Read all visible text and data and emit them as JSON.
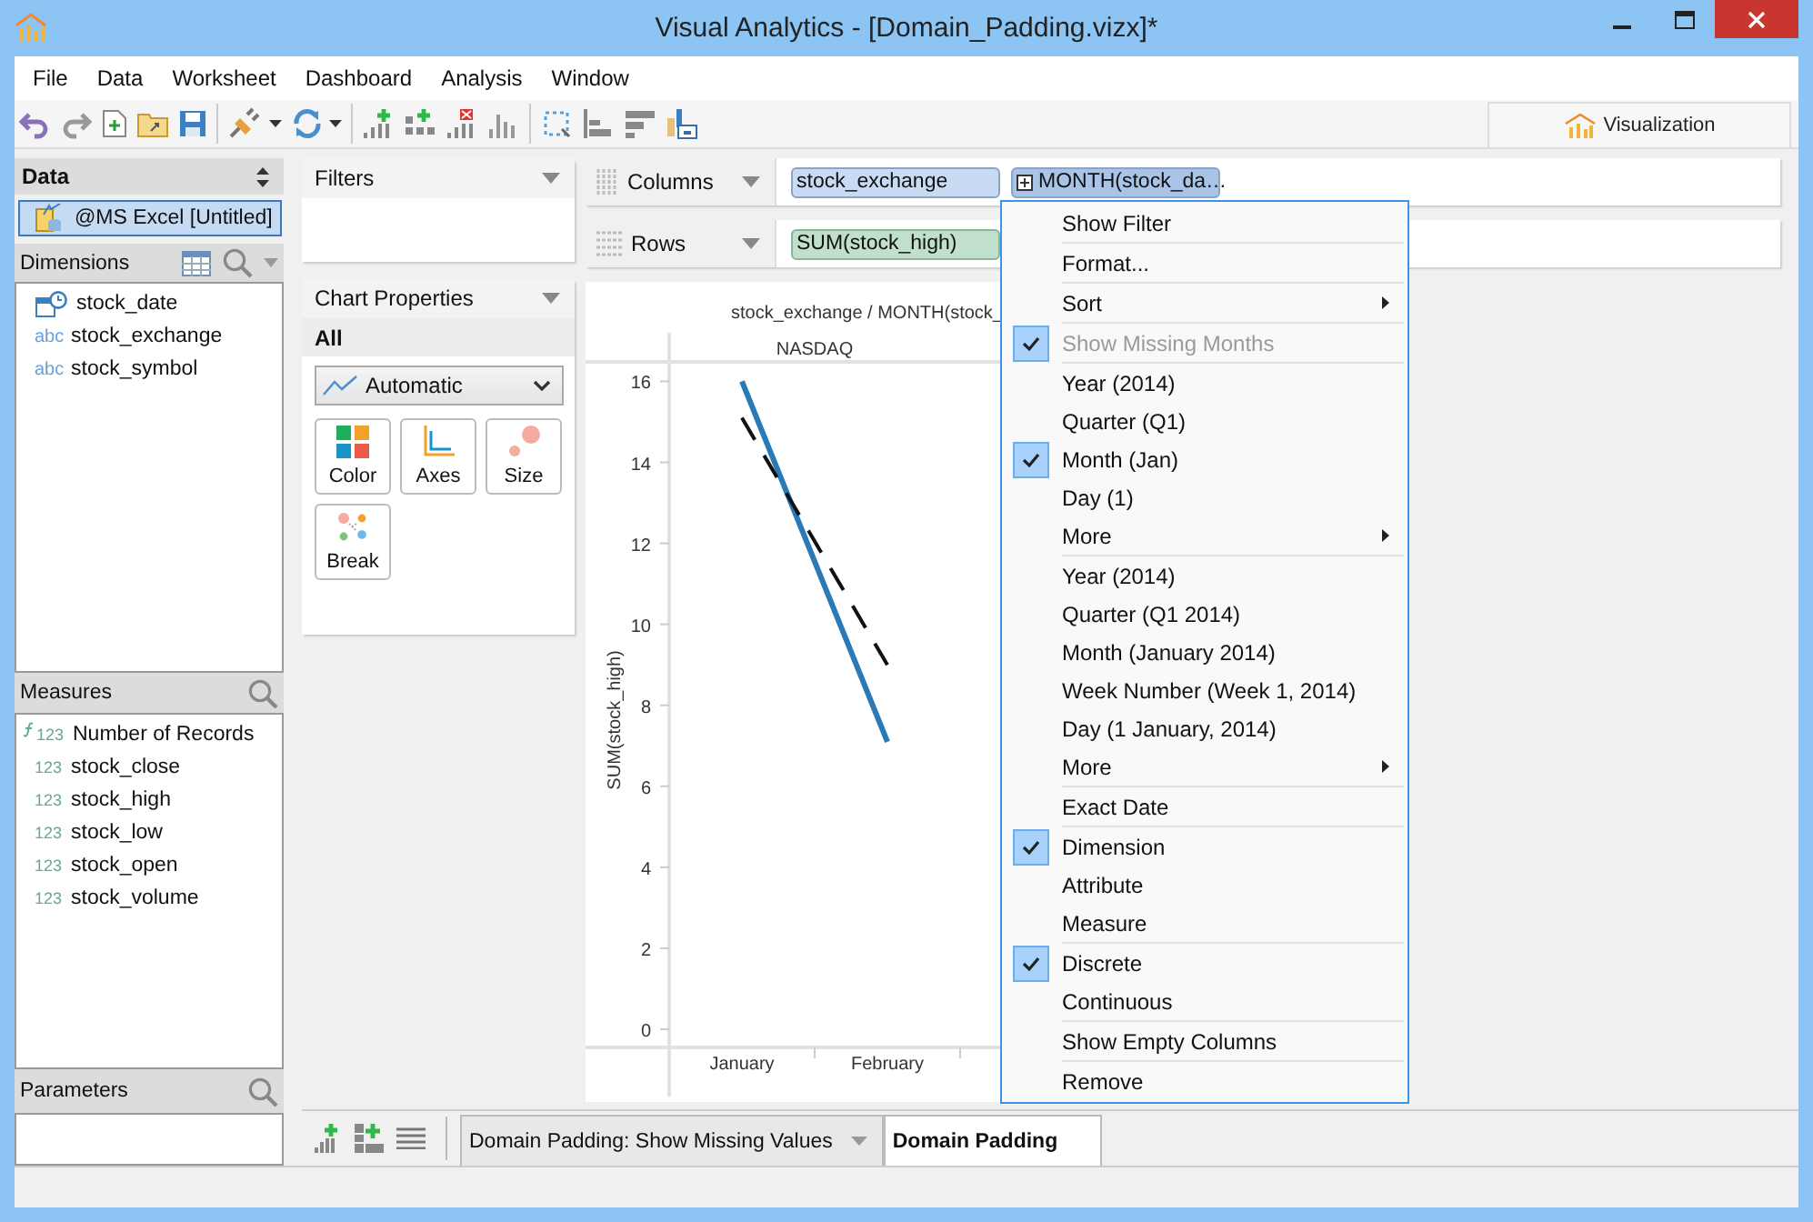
{
  "window": {
    "title": "Visual Analytics - [Domain_Padding.vizx]*"
  },
  "menu": [
    "File",
    "Data",
    "Worksheet",
    "Dashboard",
    "Analysis",
    "Window"
  ],
  "toolbar_tab": {
    "label": "Visualization"
  },
  "data_panel": {
    "title": "Data",
    "source": {
      "label": "@MS Excel [Untitled]",
      "selected": true
    }
  },
  "dimensions": {
    "title": "Dimensions",
    "items": [
      {
        "kind": "date",
        "label": "stock_date"
      },
      {
        "kind": "text",
        "badge": "abc",
        "label": "stock_exchange"
      },
      {
        "kind": "text",
        "badge": "abc",
        "label": "stock_symbol"
      }
    ]
  },
  "measures": {
    "title": "Measures",
    "items": [
      {
        "kind": "calculated",
        "badge": "123",
        "label": "Number of Records"
      },
      {
        "kind": "number",
        "badge": "123",
        "label": "stock_close"
      },
      {
        "kind": "number",
        "badge": "123",
        "label": "stock_high"
      },
      {
        "kind": "number",
        "badge": "123",
        "label": "stock_low"
      },
      {
        "kind": "number",
        "badge": "123",
        "label": "stock_open"
      },
      {
        "kind": "number",
        "badge": "123",
        "label": "stock_volume"
      }
    ]
  },
  "parameters": {
    "title": "Parameters"
  },
  "filters": {
    "title": "Filters"
  },
  "chart_properties": {
    "title": "Chart Properties",
    "section": "All",
    "mark_type": "Automatic",
    "buttons": [
      {
        "kind": "color",
        "label": "Color"
      },
      {
        "kind": "axes",
        "label": "Axes"
      },
      {
        "kind": "size",
        "label": "Size"
      },
      {
        "kind": "break",
        "label": "Break"
      }
    ]
  },
  "shelves": [
    {
      "kind": "columns",
      "label": "Columns",
      "pills": [
        {
          "kind": "dimension",
          "label": "stock_exchange"
        },
        {
          "kind": "date",
          "label": "MONTH(stock_da…"
        }
      ]
    },
    {
      "kind": "rows",
      "label": "Rows",
      "pills": [
        {
          "kind": "measure",
          "label": "SUM(stock_high)"
        }
      ]
    }
  ],
  "chart": {
    "header": "stock_exchange / MONTH(stock_",
    "pane": "NASDAQ",
    "chart_data": {
      "type": "line",
      "ylabel": "SUM(stock_high)",
      "categories": [
        "January",
        "February",
        null
      ],
      "ylim": [
        -0.45,
        17.2
      ],
      "yticks": [
        0,
        2,
        4,
        6,
        8,
        10,
        12,
        14,
        16
      ],
      "series": [
        {
          "color": "#2a7ab8",
          "line_style": "solid",
          "values": [
            16,
            7.1,
            null
          ]
        },
        {
          "color": "#111111",
          "line_style": "dashed",
          "values": [
            15.1,
            9.0,
            null
          ]
        }
      ]
    }
  },
  "sheet_tabs": [
    {
      "label": "Domain Padding: Show Missing Values",
      "selected": false
    },
    {
      "label": "Domain Padding",
      "selected": true
    }
  ],
  "context_menu": [
    {
      "items": [
        {
          "label": "Show Filter",
          "checked": false,
          "disabled": false,
          "submenu": false
        }
      ]
    },
    {
      "items": [
        {
          "label": "Format...",
          "checked": false,
          "disabled": false,
          "submenu": false
        }
      ]
    },
    {
      "items": [
        {
          "label": "Sort",
          "checked": false,
          "disabled": false,
          "submenu": true
        }
      ]
    },
    {
      "items": [
        {
          "label": "Show Missing Months",
          "checked": true,
          "disabled": true,
          "submenu": false
        }
      ]
    },
    {
      "items": [
        {
          "label": "Year (2014)",
          "checked": false,
          "disabled": false,
          "submenu": false
        },
        {
          "label": "Quarter (Q1)",
          "checked": false,
          "disabled": false,
          "submenu": false
        },
        {
          "label": "Month (Jan)",
          "checked": true,
          "disabled": false,
          "submenu": false
        },
        {
          "label": "Day (1)",
          "checked": false,
          "disabled": false,
          "submenu": false
        },
        {
          "label": "More",
          "checked": false,
          "disabled": false,
          "submenu": true
        }
      ]
    },
    {
      "items": [
        {
          "label": "Year (2014)",
          "checked": false,
          "disabled": false,
          "submenu": false
        },
        {
          "label": "Quarter (Q1 2014)",
          "checked": false,
          "disabled": false,
          "submenu": false
        },
        {
          "label": "Month (January 2014)",
          "checked": false,
          "disabled": false,
          "submenu": false
        },
        {
          "label": "Week Number (Week 1, 2014)",
          "checked": false,
          "disabled": false,
          "submenu": false
        },
        {
          "label": "Day (1 January, 2014)",
          "checked": false,
          "disabled": false,
          "submenu": false
        },
        {
          "label": "More",
          "checked": false,
          "disabled": false,
          "submenu": true
        }
      ]
    },
    {
      "items": [
        {
          "label": "Exact Date",
          "checked": false,
          "disabled": false,
          "submenu": false
        }
      ]
    },
    {
      "items": [
        {
          "label": "Dimension",
          "checked": true,
          "disabled": false,
          "submenu": false
        },
        {
          "label": "Attribute",
          "checked": false,
          "disabled": false,
          "submenu": false
        },
        {
          "label": "Measure",
          "checked": false,
          "disabled": false,
          "submenu": false
        }
      ]
    },
    {
      "items": [
        {
          "label": "Discrete",
          "checked": true,
          "disabled": false,
          "submenu": false
        },
        {
          "label": "Continuous",
          "checked": false,
          "disabled": false,
          "submenu": false
        }
      ]
    },
    {
      "items": [
        {
          "label": "Show Empty Columns",
          "checked": false,
          "disabled": false,
          "submenu": false
        }
      ]
    },
    {
      "items": [
        {
          "label": "Remove",
          "checked": false,
          "disabled": false,
          "submenu": false
        }
      ]
    }
  ]
}
